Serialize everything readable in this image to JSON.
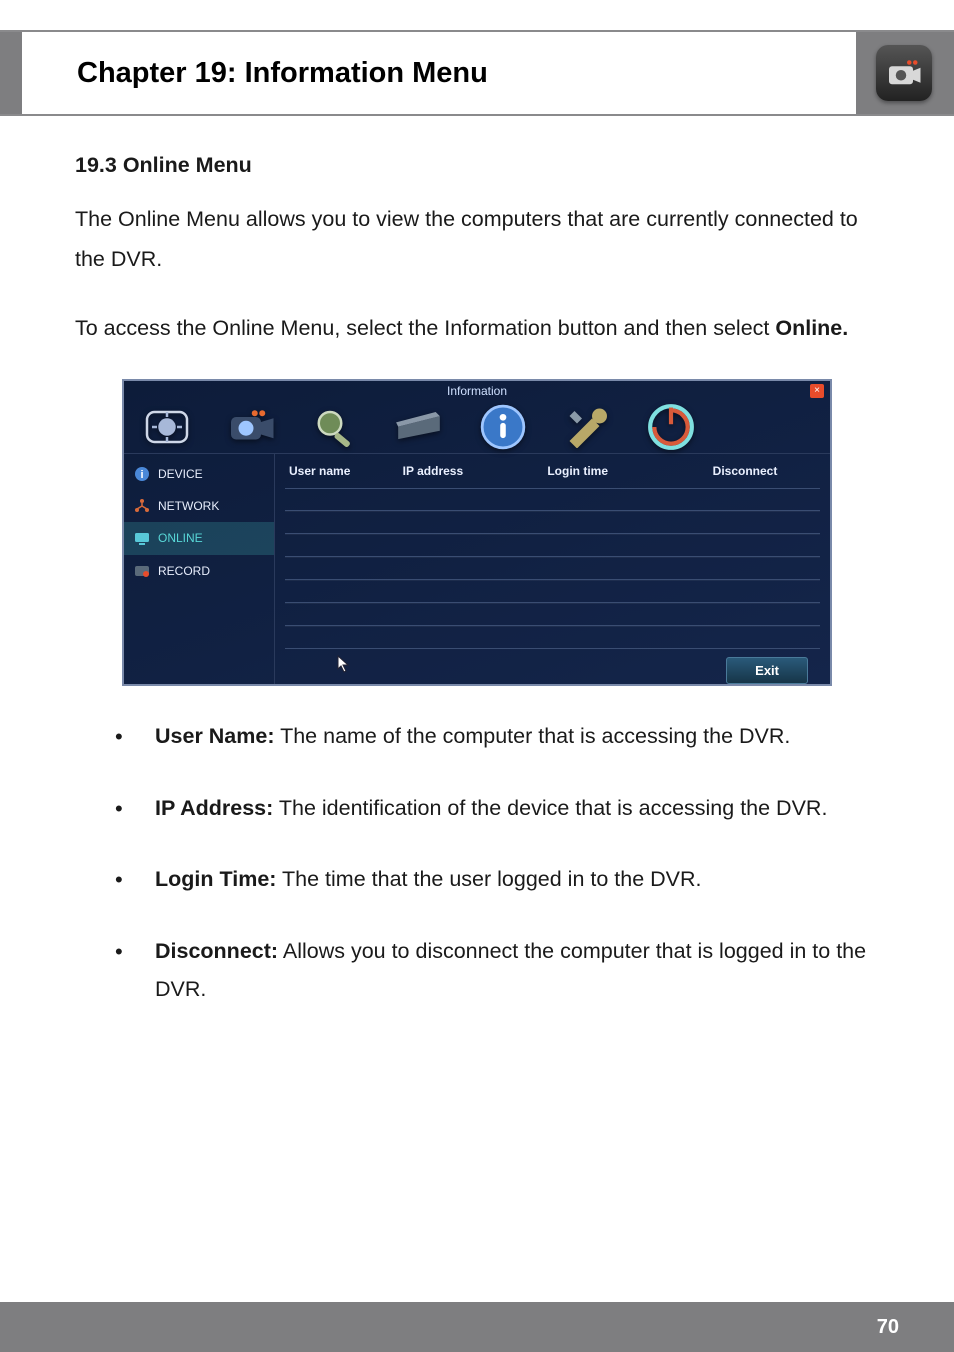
{
  "header": {
    "title": "Chapter 19: Information Menu",
    "icon_name": "camera-icon"
  },
  "section": {
    "heading": "19.3 Online Menu",
    "para1": "The Online Menu allows you to view the computers that are currently connected to the DVR.",
    "para2_pre": "To access the Online Menu, select the Information button and then select ",
    "para2_bold": "Online."
  },
  "screenshot": {
    "title": "Information",
    "close_label": "×",
    "top_icons": [
      "settings",
      "camera",
      "search",
      "drive",
      "info",
      "tools",
      "power"
    ],
    "sidebar": [
      {
        "label": "DEVICE",
        "icon": "info-circle",
        "selected": false
      },
      {
        "label": "NETWORK",
        "icon": "network-nodes",
        "selected": false
      },
      {
        "label": "ONLINE",
        "icon": "monitor",
        "selected": true
      },
      {
        "label": "RECORD",
        "icon": "record-dot",
        "selected": false
      }
    ],
    "columns": [
      "User name",
      "IP address",
      "Login time",
      "Disconnect"
    ],
    "row_count": 7,
    "exit_label": "Exit"
  },
  "definitions": [
    {
      "term": "User Name:",
      "desc": " The name of the computer that is accessing the DVR."
    },
    {
      "term": "IP Address:",
      "desc": " The identification of the device that is accessing the DVR."
    },
    {
      "term": "Login Time:",
      "desc": " The time that the user logged in to the DVR."
    },
    {
      "term": "Disconnect:",
      "desc": " Allows you to disconnect the computer that is logged in to the DVR."
    }
  ],
  "footer": {
    "page_number": "70"
  }
}
